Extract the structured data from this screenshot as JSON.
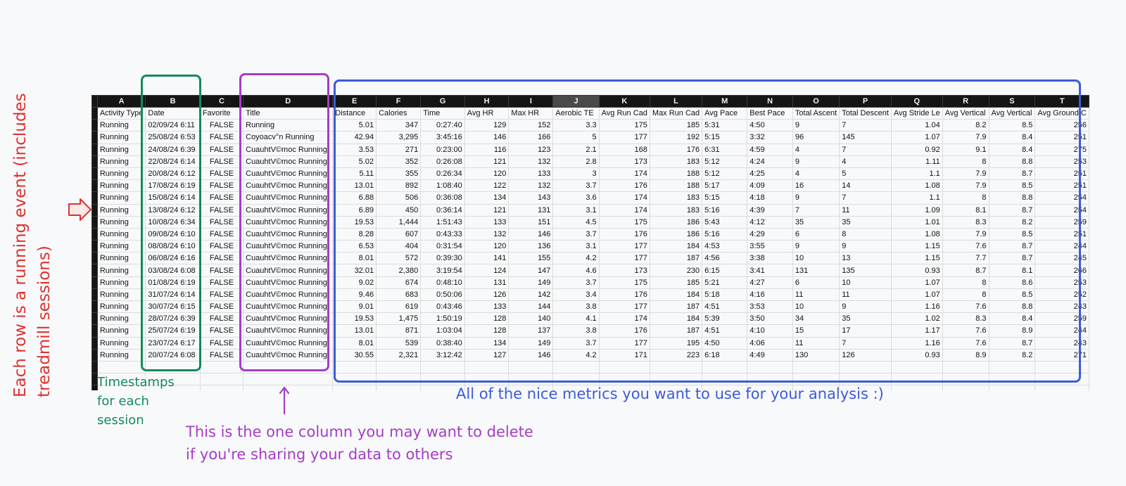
{
  "column_letters": [
    "A",
    "B",
    "C",
    "D",
    "E",
    "F",
    "G",
    "H",
    "I",
    "J",
    "K",
    "L",
    "M",
    "N",
    "O",
    "P",
    "Q",
    "R",
    "S",
    "T"
  ],
  "selected_column": "J",
  "headers": [
    "Activity Type",
    "Date",
    "Favorite",
    "Title",
    "Distance",
    "Calories",
    "Time",
    "Avg HR",
    "Max HR",
    "Aerobic TE",
    "Avg Run Cad",
    "Max Run Cad",
    "Avg Pace",
    "Best Pace",
    "Total Ascent",
    "Total Descent",
    "Avg Stride Le",
    "Avg Vertical",
    "Avg Vertical",
    "Avg Ground C"
  ],
  "rows": [
    [
      "Running",
      "02/09/24 6:11",
      "FALSE",
      "Running",
      "5.01",
      "347",
      "0:27:40",
      "129",
      "152",
      "3.3",
      "175",
      "185",
      "5:31",
      "4:50",
      "9",
      "7",
      "1.04",
      "8.2",
      "8.5",
      "256"
    ],
    [
      "Running",
      "25/08/24 6:53",
      "FALSE",
      "Coyoacv°n Running",
      "42.94",
      "3,295",
      "3:45:16",
      "146",
      "166",
      "5",
      "177",
      "192",
      "5:15",
      "3:32",
      "96",
      "145",
      "1.07",
      "7.9",
      "8.4",
      "251"
    ],
    [
      "Running",
      "24/08/24 6:39",
      "FALSE",
      "CuauhtV©moc Running",
      "3.53",
      "271",
      "0:23:00",
      "116",
      "123",
      "2.1",
      "168",
      "176",
      "6:31",
      "4:59",
      "4",
      "7",
      "0.92",
      "9.1",
      "8.4",
      "275"
    ],
    [
      "Running",
      "22/08/24 6:14",
      "FALSE",
      "CuauhtV©moc Running",
      "5.02",
      "352",
      "0:26:08",
      "121",
      "132",
      "2.8",
      "173",
      "183",
      "5:12",
      "4:24",
      "9",
      "4",
      "1.11",
      "8",
      "8.8",
      "253"
    ],
    [
      "Running",
      "20/08/24 6:12",
      "FALSE",
      "CuauhtV©moc Running",
      "5.11",
      "355",
      "0:26:34",
      "120",
      "133",
      "3",
      "174",
      "188",
      "5:12",
      "4:25",
      "4",
      "5",
      "1.1",
      "7.9",
      "8.7",
      "251"
    ],
    [
      "Running",
      "17/08/24 6:19",
      "FALSE",
      "CuauhtV©moc Running",
      "13.01",
      "892",
      "1:08:40",
      "122",
      "132",
      "3.7",
      "176",
      "188",
      "5:17",
      "4:09",
      "16",
      "14",
      "1.08",
      "7.9",
      "8.5",
      "251"
    ],
    [
      "Running",
      "15/08/24 6:14",
      "FALSE",
      "CuauhtV©moc Running",
      "6.88",
      "506",
      "0:36:08",
      "134",
      "143",
      "3.6",
      "174",
      "183",
      "5:15",
      "4:18",
      "9",
      "7",
      "1.1",
      "8",
      "8.8",
      "254"
    ],
    [
      "Running",
      "13/08/24 6:12",
      "FALSE",
      "CuauhtV©moc Running",
      "6.89",
      "450",
      "0:36:14",
      "121",
      "131",
      "3.1",
      "174",
      "183",
      "5:16",
      "4:39",
      "7",
      "11",
      "1.09",
      "8.1",
      "8.7",
      "254"
    ],
    [
      "Running",
      "10/08/24 6:34",
      "FALSE",
      "CuauhtV©moc Running",
      "19.53",
      "1,444",
      "1:51:43",
      "133",
      "151",
      "4.5",
      "175",
      "186",
      "5:43",
      "4:12",
      "35",
      "35",
      "1.01",
      "8.3",
      "8.2",
      "259"
    ],
    [
      "Running",
      "09/08/24 6:10",
      "FALSE",
      "CuauhtV©moc Running",
      "8.28",
      "607",
      "0:43:33",
      "132",
      "146",
      "3.7",
      "176",
      "186",
      "5:16",
      "4:29",
      "6",
      "8",
      "1.08",
      "7.9",
      "8.5",
      "251"
    ],
    [
      "Running",
      "08/08/24 6:10",
      "FALSE",
      "CuauhtV©moc Running",
      "6.53",
      "404",
      "0:31:54",
      "120",
      "136",
      "3.1",
      "177",
      "184",
      "4:53",
      "3:55",
      "9",
      "9",
      "1.15",
      "7.6",
      "8.7",
      "244"
    ],
    [
      "Running",
      "06/08/24 6:16",
      "FALSE",
      "CuauhtV©moc Running",
      "8.01",
      "572",
      "0:39:30",
      "141",
      "155",
      "4.2",
      "177",
      "187",
      "4:56",
      "3:38",
      "10",
      "13",
      "1.15",
      "7.7",
      "8.7",
      "245"
    ],
    [
      "Running",
      "03/08/24 6:08",
      "FALSE",
      "CuauhtV©moc Running",
      "32.01",
      "2,380",
      "3:19:54",
      "124",
      "147",
      "4.6",
      "173",
      "230",
      "6:15",
      "3:41",
      "131",
      "135",
      "0.93",
      "8.7",
      "8.1",
      "266"
    ],
    [
      "Running",
      "01/08/24 6:19",
      "FALSE",
      "CuauhtV©moc Running",
      "9.02",
      "674",
      "0:48:10",
      "131",
      "149",
      "3.7",
      "175",
      "185",
      "5:21",
      "4:27",
      "6",
      "10",
      "1.07",
      "8",
      "8.6",
      "253"
    ],
    [
      "Running",
      "31/07/24 6:14",
      "FALSE",
      "CuauhtV©moc Running",
      "9.46",
      "683",
      "0:50:06",
      "126",
      "142",
      "3.4",
      "176",
      "184",
      "5:18",
      "4:16",
      "11",
      "11",
      "1.07",
      "8",
      "8.5",
      "252"
    ],
    [
      "Running",
      "30/07/24 6:15",
      "FALSE",
      "CuauhtV©moc Running",
      "9.01",
      "619",
      "0:43:46",
      "133",
      "144",
      "3.8",
      "177",
      "187",
      "4:51",
      "3:53",
      "10",
      "9",
      "1.16",
      "7.6",
      "8.8",
      "243"
    ],
    [
      "Running",
      "28/07/24 6:39",
      "FALSE",
      "CuauhtV©moc Running",
      "19.53",
      "1,475",
      "1:50:19",
      "128",
      "140",
      "4.1",
      "174",
      "184",
      "5:39",
      "3:50",
      "34",
      "35",
      "1.02",
      "8.3",
      "8.4",
      "259"
    ],
    [
      "Running",
      "25/07/24 6:19",
      "FALSE",
      "CuauhtV©moc Running",
      "13.01",
      "871",
      "1:03:04",
      "128",
      "137",
      "3.8",
      "176",
      "187",
      "4:51",
      "4:10",
      "15",
      "17",
      "1.17",
      "7.6",
      "8.9",
      "244"
    ],
    [
      "Running",
      "23/07/24 6:17",
      "FALSE",
      "CuauhtV©moc Running",
      "8.01",
      "539",
      "0:38:40",
      "134",
      "149",
      "3.7",
      "177",
      "195",
      "4:50",
      "4:06",
      "11",
      "7",
      "1.16",
      "7.6",
      "8.7",
      "243"
    ],
    [
      "Running",
      "20/07/24 6:08",
      "FALSE",
      "CuauhtV©moc Running",
      "30.55",
      "2,321",
      "3:12:42",
      "127",
      "146",
      "4.2",
      "171",
      "223",
      "6:18",
      "4:49",
      "130",
      "126",
      "0.93",
      "8.9",
      "8.2",
      "271"
    ]
  ],
  "empty_rows": 3,
  "annotations": {
    "rows_note": "Each row is a running event (includes treadmill sessions)",
    "timestamps_note": [
      "Timestamps",
      "for each",
      "session"
    ],
    "title_note": [
      "This is the one column you may want to delete",
      "if you're sharing your data to others"
    ],
    "metrics_note": "All of the nice metrics you want to use for your analysis :)"
  },
  "colors": {
    "red": "#e0312e",
    "green": "#148a5c",
    "purple": "#a63cc8",
    "blue": "#3d5bd9",
    "header_bg": "#151515"
  }
}
